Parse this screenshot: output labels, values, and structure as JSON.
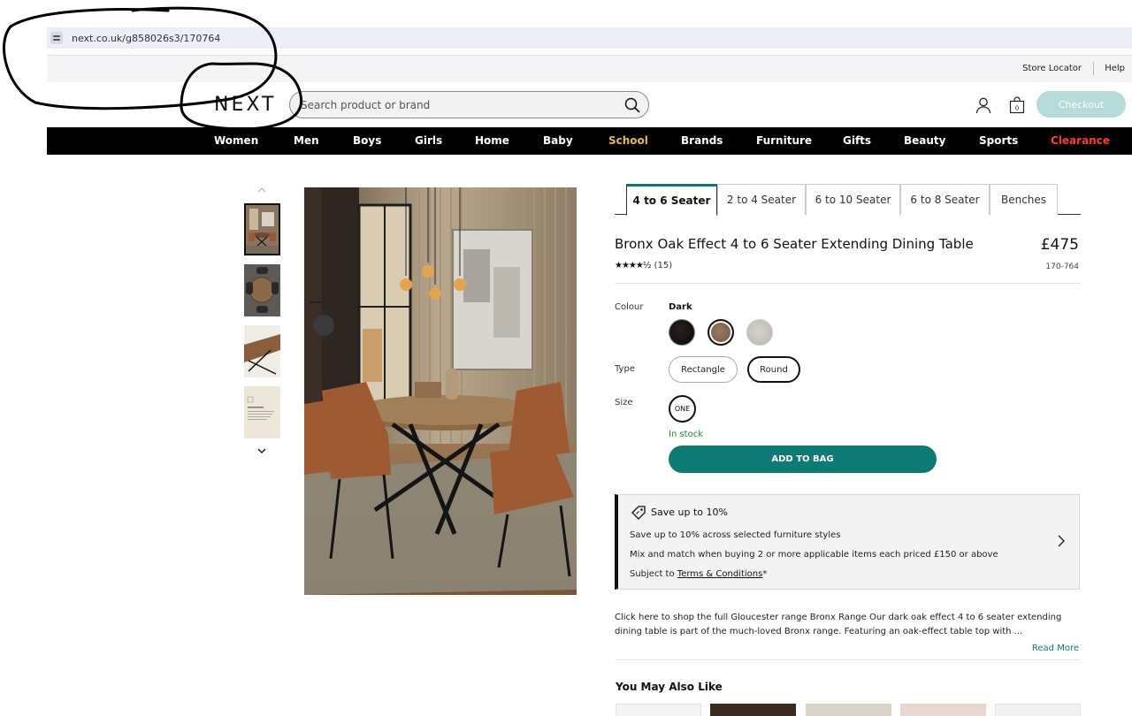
{
  "browser": {
    "url": "next.co.uk/g858026s3/170764"
  },
  "utility": {
    "store_locator": "Store Locator",
    "help": "Help"
  },
  "header": {
    "logo": "NEXT",
    "search_placeholder": "Search product or brand",
    "search_value": "earch product or brand",
    "checkout": "Checkout",
    "bag_count": "0"
  },
  "nav": {
    "items": [
      "Women",
      "Men",
      "Boys",
      "Girls",
      "Home",
      "Baby",
      "School",
      "Brands",
      "Furniture",
      "Gifts",
      "Beauty",
      "Sports",
      "Clearance"
    ],
    "highlight_colors": {
      "School": "#e8b84a",
      "Clearance": "#ff3b30"
    }
  },
  "tabs": [
    "4 to 6 Seater",
    "2 to 4 Seater",
    "6 to 10 Seater",
    "6 to 8 Seater",
    "Benches"
  ],
  "product": {
    "title": "Bronx Oak Effect 4 to 6 Seater Extending Dining Table",
    "price": "£475",
    "rating_stars": "★★★★½",
    "rating_value": 4.5,
    "review_count": "(15)",
    "item_code": "170-764"
  },
  "options": {
    "colour_label": "Colour",
    "colour_value": "Dark",
    "type_label": "Type",
    "types": [
      "Rectangle",
      "Round"
    ],
    "size_label": "Size",
    "size_value": "ONE",
    "stock": "In stock",
    "add_to_bag": "ADD TO BAG"
  },
  "promo": {
    "title": "Save up to 10%",
    "line1": "Save up to 10% across selected furniture styles",
    "line2": "Mix and match when buying 2 or more applicable items each priced £150 or above",
    "line3_prefix": "Subject to ",
    "line3_link": "Terms & Conditions",
    "line3_suffix": "*"
  },
  "description": {
    "text": "Click here to shop the full Gloucester range Bronx Range Our dark oak effect 4 to 6 seater extending dining table is part of the much-loved Bronx range. Featuring an oak-effect table top with ...",
    "read_more": "Read More"
  },
  "also_like": {
    "title": "You May Also Like"
  },
  "colors": {
    "accent": "#0f7a74",
    "checkout_bg": "#b5dcd9",
    "nav_bg": "#000000",
    "in_stock": "#1f8a3a"
  }
}
